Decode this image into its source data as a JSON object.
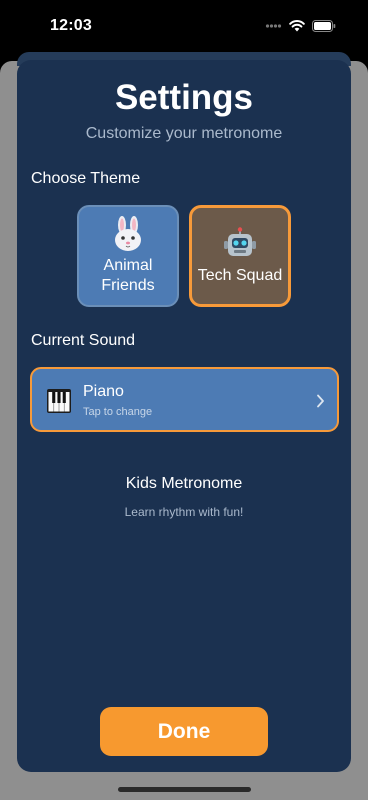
{
  "status_bar": {
    "time": "12:03",
    "icons": [
      "signal-dots-icon",
      "wifi-icon",
      "battery-icon"
    ]
  },
  "settings": {
    "title": "Settings",
    "subtitle": "Customize your metronome",
    "choose_theme_label": "Choose Theme",
    "themes": [
      {
        "name": "Animal Friends",
        "icon": "bunny-icon",
        "selected": false
      },
      {
        "name": "Tech Squad",
        "icon": "robot-icon",
        "selected": true
      }
    ],
    "current_sound_label": "Current Sound",
    "sound": {
      "icon": "piano-icon",
      "name": "Piano",
      "hint": "Tap to change"
    },
    "app_name": "Kids Metronome",
    "tagline": "Learn rhythm with fun!",
    "done_label": "Done"
  },
  "colors": {
    "sheet_bg": "#1b3150",
    "card_blue": "#4d7bb4",
    "accent_orange": "#f7992f",
    "tech_card_bg": "#6c5a4a",
    "muted_text": "#aab9cc"
  }
}
